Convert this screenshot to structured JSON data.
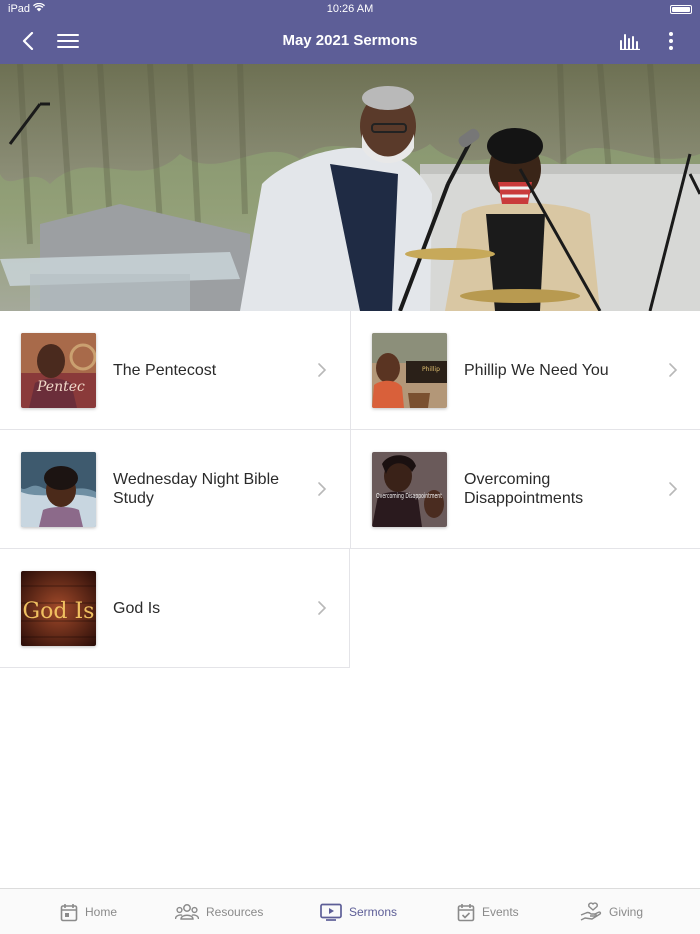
{
  "status_bar": {
    "device": "iPad",
    "time": "10:26 AM"
  },
  "nav": {
    "title": "May 2021 Sermons",
    "icons": [
      "back-icon",
      "hamburger-menu-icon",
      "bar-chart-icon",
      "more-vertical-icon"
    ]
  },
  "colors": {
    "header": "#5d5e97",
    "active_tab": "#5d5e97",
    "inactive_tab": "#8a8a8a"
  },
  "sermons": [
    {
      "title": "The Pentecost",
      "thumb_text": "Pentec"
    },
    {
      "title": "Phillip We Need You",
      "thumb_text": "Phillip"
    },
    {
      "title": "Wednesday Night Bible Study",
      "thumb_text": ""
    },
    {
      "title": "Overcoming Disappointments",
      "thumb_text": "Overcoming Disappointment"
    },
    {
      "title": "God Is",
      "thumb_text": "God Is"
    }
  ],
  "tabs": [
    {
      "label": "Home",
      "icon": "calendar-icon"
    },
    {
      "label": "Resources",
      "icon": "people-icon"
    },
    {
      "label": "Sermons",
      "icon": "video-play-icon",
      "active": true
    },
    {
      "label": "Events",
      "icon": "calendar-check-icon"
    },
    {
      "label": "Giving",
      "icon": "hand-heart-icon"
    }
  ]
}
